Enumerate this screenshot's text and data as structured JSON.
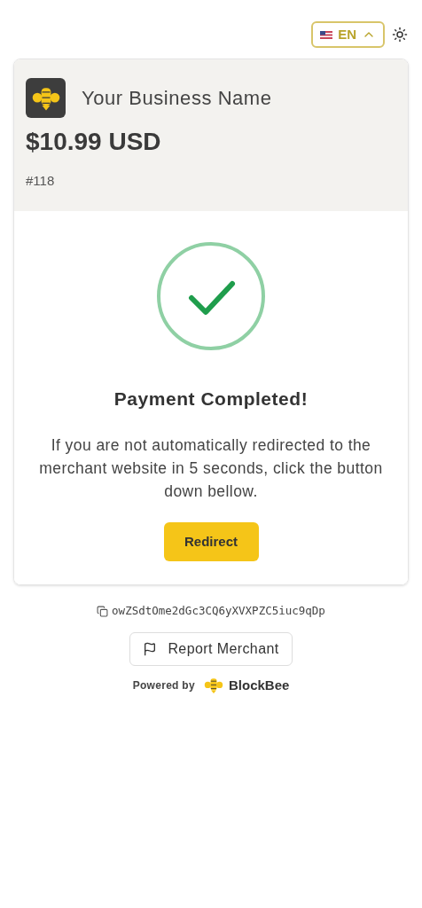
{
  "language": {
    "code": "EN"
  },
  "merchant": {
    "name": "Your Business Name",
    "amount": "$10.99 USD",
    "order": "#118"
  },
  "status": {
    "title": "Payment Completed!",
    "message": "If you are not automatically redirected to the merchant website in 5 seconds, click the button down bellow.",
    "button": "Redirect"
  },
  "address": "owZSdtOme2dGc3CQ6yXVXPZC5iuc9qDp",
  "report_button": "Report Merchant",
  "footer": {
    "powered_by": "Powered by",
    "brand": "BlockBee"
  }
}
